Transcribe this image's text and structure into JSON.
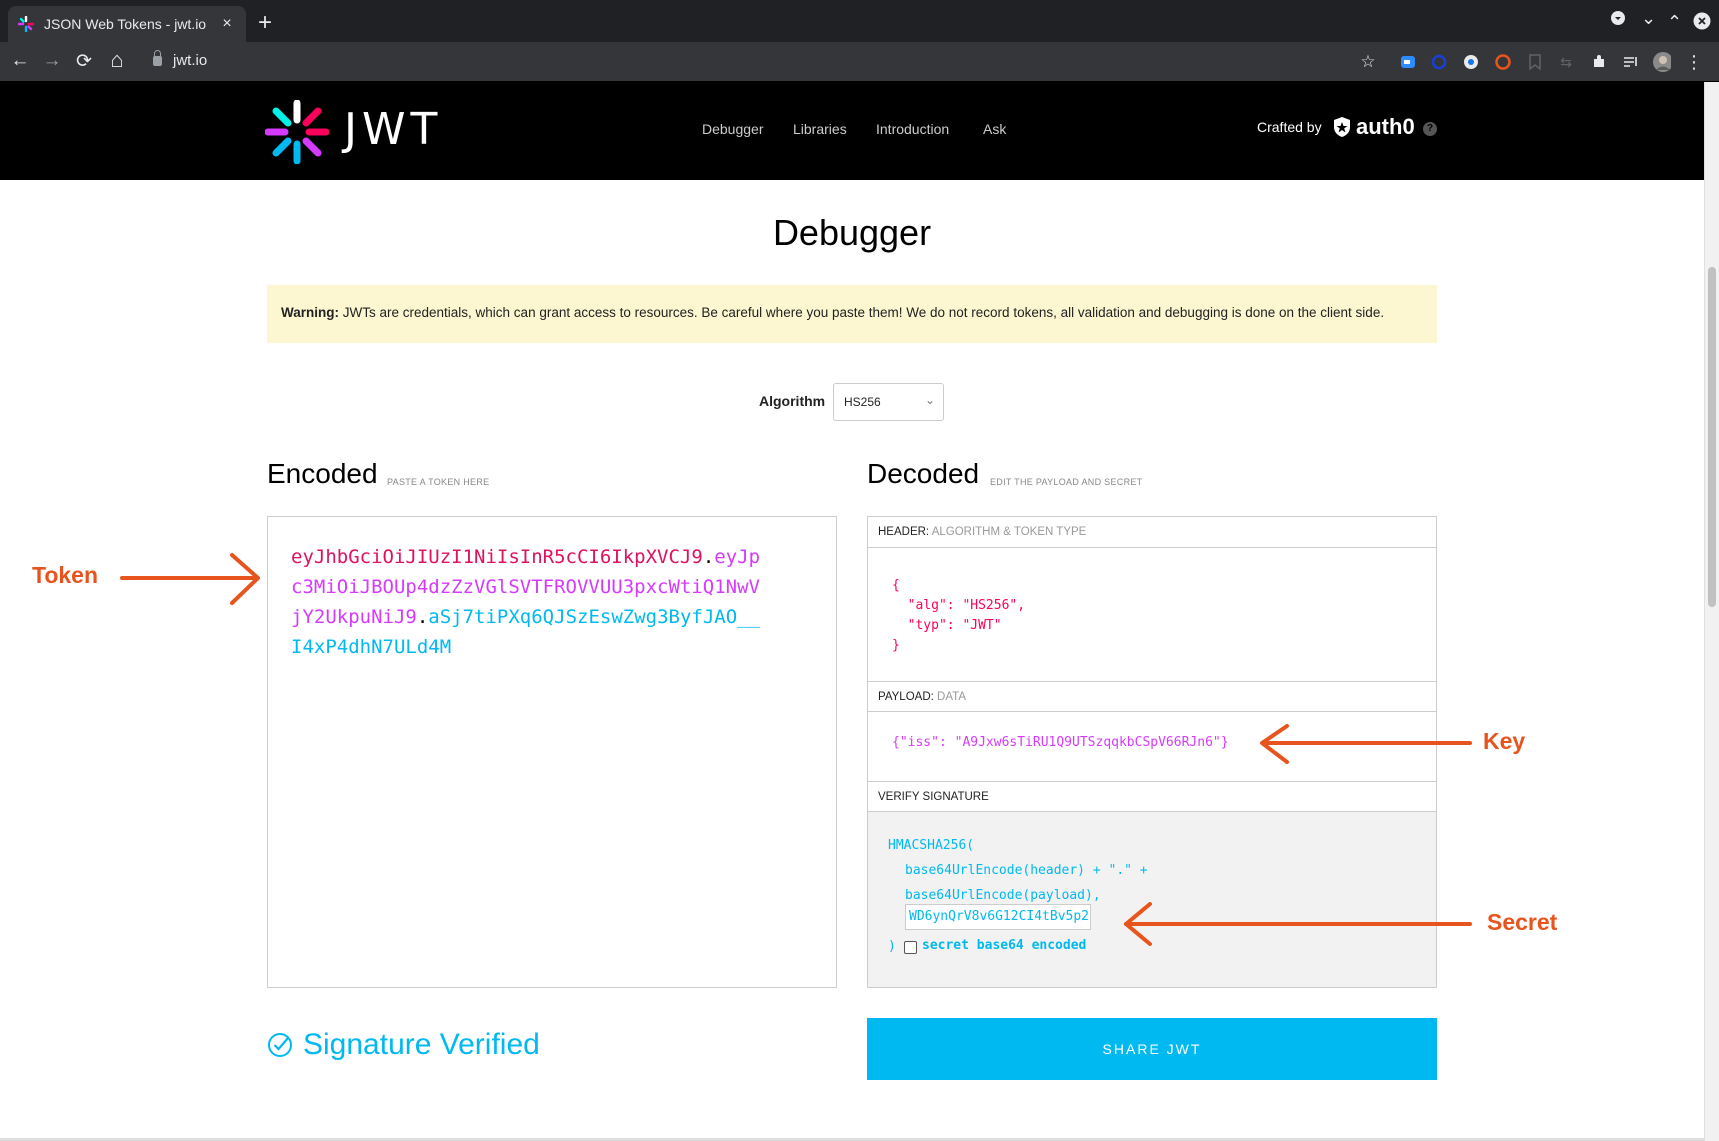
{
  "browser": {
    "tab_title": "JSON Web Tokens - jwt.io",
    "tab_close": "×",
    "new_tab": "+",
    "url": "jwt.io",
    "nav": {
      "back": "←",
      "forward": "→",
      "reload": "⟳",
      "home": "⌂"
    },
    "window_controls": {
      "profile": "▾",
      "chevron_down": "⌄",
      "chevron_up": "⌃",
      "close": "✕"
    },
    "extensions": {
      "star": "☆",
      "puzzle": "✱",
      "more": "⋮"
    }
  },
  "site": {
    "logo_text": "JWT",
    "nav": [
      "Debugger",
      "Libraries",
      "Introduction",
      "Ask"
    ],
    "crafted_by": "Crafted by",
    "brand": "auth0",
    "help": "?"
  },
  "page": {
    "title": "Debugger",
    "warning_bold": "Warning:",
    "warning_text": " JWTs are credentials, which can grant access to resources. Be careful where you paste them! We do not record tokens, all validation and debugging is done on the client side.",
    "algorithm_label": "Algorithm",
    "algorithm_value": "HS256"
  },
  "encoded": {
    "heading": "Encoded",
    "sub": "PASTE A TOKEN HERE",
    "token_header": "eyJhbGciOiJIUzI1NiIsInR5cCI6IkpXVCJ9",
    "token_payload": "eyJpc3MiOiJBOUp4dzZzVGlSVTFROVVUU3pxcWtiQ1NwVjY2UkpuNiJ9",
    "token_signature": "aSj7tiPXq6QJSzEswZwg3ByfJAO__I4xP4dhN7ULd4M",
    "dot": "."
  },
  "decoded": {
    "heading": "Decoded",
    "sub": "EDIT THE PAYLOAD AND SECRET",
    "header_label": "HEADER:",
    "header_sub": "ALGORITHM & TOKEN TYPE",
    "header_json": "{\n  \"alg\": \"HS256\",\n  \"typ\": \"JWT\"\n}",
    "payload_label": "PAYLOAD:",
    "payload_sub": "DATA",
    "payload_json": "{\"iss\": \"A9Jxw6sTiRU1Q9UTSzqqkbCSpV66RJn6\"}",
    "verify_label": "VERIFY SIGNATURE",
    "verify_line1": "HMACSHA256(",
    "verify_line2": "base64UrlEncode(header) + \".\" +",
    "verify_line3": "base64UrlEncode(payload),",
    "secret_value": "WD6ynQrV8v6G12CI4tBv5p2",
    "verify_close": ")",
    "secret_base64_label": "secret base64 encoded",
    "secret_base64_checked": false
  },
  "status": {
    "signature": "Signature Verified",
    "share_button": "SHARE JWT"
  },
  "annotations": {
    "token": "Token",
    "key": "Key",
    "secret": "Secret",
    "color": "#e8541e"
  },
  "colors": {
    "token_header": "#e0115f",
    "token_payload": "#d63aff",
    "token_signature": "#00b9f1",
    "warning_bg": "#fcf7d0",
    "share_button": "#00b9f1"
  }
}
